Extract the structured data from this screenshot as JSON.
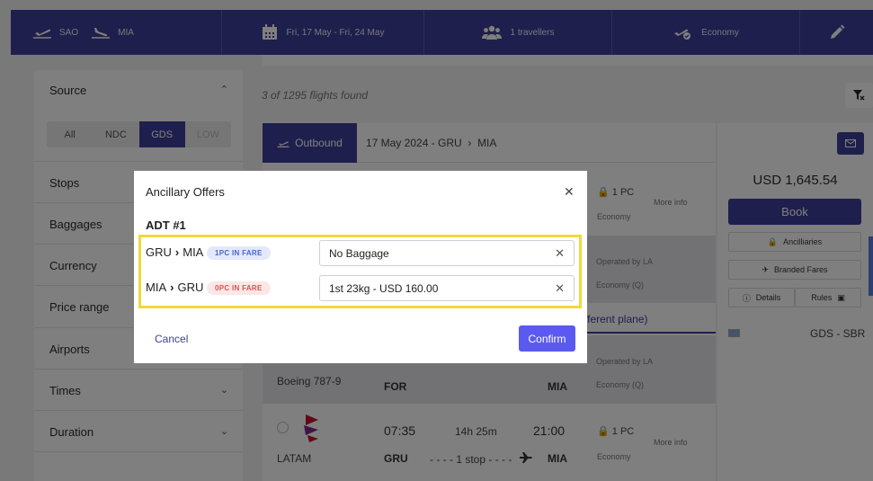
{
  "search": {
    "origin": "SAO",
    "destination": "MIA",
    "dates": "Fri, 17 May - Fri, 24 May",
    "travellers": "1 travellers",
    "cabin": "Economy"
  },
  "filters": {
    "source_title": "Source",
    "source_options": [
      "All",
      "NDC",
      "GDS",
      "LOW"
    ],
    "sections": [
      "Stops",
      "Baggages",
      "Currency",
      "Price range",
      "Airports",
      "Times",
      "Duration"
    ]
  },
  "results": {
    "count_text": "3 of 1295 flights found",
    "outbound_label": "Outbound",
    "outbound_date": "17 May 2024 - GRU",
    "outbound_dest": "MIA",
    "row1": {
      "baggage": "1 PC",
      "cabin": "Economy",
      "more_info": "More info"
    },
    "row2": {
      "operated": "Operated by LA",
      "cabin": "Economy (Q)"
    },
    "notice": "fferent plane)",
    "row3": {
      "aircraft": "Boeing 787-9",
      "from": "FOR",
      "to": "MIA",
      "operated": "Operated by LA",
      "cabin": "Economy (Q)"
    },
    "row4": {
      "airline": "LATAM",
      "depart_time": "07:35",
      "duration": "14h 25m",
      "arrive_time": "21:00",
      "from": "GRU",
      "stops": "- - - - 1 stop - - - -",
      "to": "MIA",
      "baggage": "1 PC",
      "cabin": "Economy",
      "more_info": "More info"
    }
  },
  "price_panel": {
    "price": "USD 1,645.54",
    "book": "Book",
    "ancilliaries": "Ancilliaries",
    "branded_fares": "Branded Fares",
    "details": "Details",
    "rules": "Rules",
    "source": "GDS - SBR"
  },
  "modal": {
    "title": "Ancillary Offers",
    "passenger": "ADT #1",
    "legs": [
      {
        "from": "GRU",
        "to": "MIA",
        "badge": "1PC IN FARE",
        "selection": "No Baggage"
      },
      {
        "from": "MIA",
        "to": "GRU",
        "badge": "0PC IN FARE",
        "selection": "1st 23kg - USD 160.00"
      }
    ],
    "cancel": "Cancel",
    "confirm": "Confirm"
  },
  "colors": {
    "primary": "#3f3f9d",
    "confirm": "#5a5af0",
    "highlight": "#efd93b",
    "badge_blue": "#4967c9",
    "badge_red": "#d9534f"
  }
}
